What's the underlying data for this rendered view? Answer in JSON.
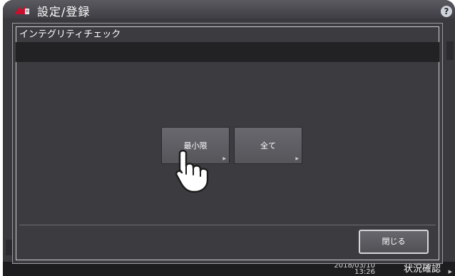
{
  "window": {
    "title": "設定/登録",
    "help_symbol": "?"
  },
  "dialog": {
    "title": "インテグリティチェック",
    "buttons": [
      {
        "label": "最小限",
        "arrow": "▶"
      },
      {
        "label": "全て",
        "arrow": "▶"
      }
    ],
    "close_label": "閉じる"
  },
  "status_bar": {
    "date": "2018/03/10",
    "time": "13:26",
    "status_label": "状況確認",
    "status_arrow": "▶"
  },
  "colors": {
    "background": "#3a3a3e",
    "dialog": "#3c3c40",
    "button": "#5f5f64",
    "logo": "#c8102e"
  }
}
